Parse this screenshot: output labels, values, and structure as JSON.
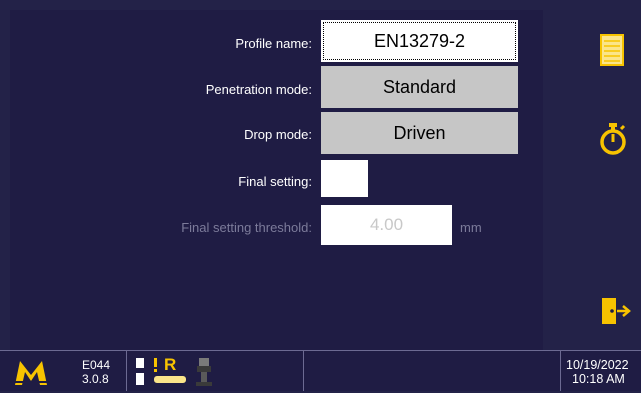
{
  "form": {
    "profile_name_label": "Profile name:",
    "profile_name_value": "EN13279-2",
    "penetration_mode_label": "Penetration mode:",
    "penetration_mode_value": "Standard",
    "drop_mode_label": "Drop mode:",
    "drop_mode_value": "Driven",
    "final_setting_label": "Final setting:",
    "final_setting_threshold_label": "Final setting threshold:",
    "final_setting_threshold_value": "4.00",
    "final_setting_threshold_unit": "mm"
  },
  "side_icons": [
    "notepad-icon",
    "stopwatch-icon",
    "exit-door-icon"
  ],
  "status": {
    "logo": "M",
    "device_code": "E044",
    "version": "3.0.8",
    "mode_letter": "R",
    "date": "10/19/2022",
    "time": "10:18 AM"
  },
  "colors": {
    "background": "#232248",
    "accent_yellow": "#f7c300",
    "field_grey": "#c6c6c6",
    "disabled_text": "#7c7b9a"
  }
}
